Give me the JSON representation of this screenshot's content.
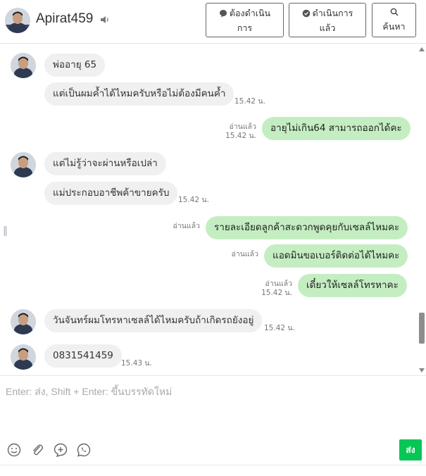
{
  "header": {
    "username": "Apirat459",
    "btn_todo_line1": "ต้องดำเนิน",
    "btn_todo_line2": "การ",
    "btn_done_line1": "ดำเนินการ",
    "btn_done_line2": "แล้ว",
    "btn_search": "ค้นหา"
  },
  "messages": [
    {
      "text": "พ่ออายุ 65"
    },
    {
      "text": "แต่เป็นผมค้ำได้ไหมครับหรือไม่ต้องมีคนค้ำ",
      "time": "15.42 น."
    },
    {
      "text": "อายุไม่เกิน64 สามารถออกได้คะ",
      "read": "อ่านแล้ว",
      "time": "15.42 น."
    },
    {
      "text": "แต่ไม่รู้ว่าจะผ่านหรือเปล่า"
    },
    {
      "text": "แม่ประกอบอาชีพค้าขายครับ",
      "time": "15.42 น."
    },
    {
      "text": "รายละเอียดลูกค้าสะดวกพูดคุยกับเซลล์ไหมคะ",
      "read": "อ่านแล้ว"
    },
    {
      "text": "แอดมินขอเบอร์ติดต่อได้ไหมคะ",
      "read": "อ่านแล้ว"
    },
    {
      "text": "เดี๋ยวให้เซลล์โทรหาคะ",
      "read": "อ่านแล้ว",
      "time": "15.42 น."
    },
    {
      "text": "วันจันทร์ผมโทรหาเซลล์ได้ไหมครับถ้าเกิดรถยังอยู่",
      "time": "15.42 น."
    },
    {
      "text": "0831541459",
      "time": "15.43 น."
    }
  ],
  "composer": {
    "placeholder": "Enter: ส่ง, Shift + Enter: ขึ้นบรรทัดใหม่"
  },
  "send_label": "ส่ง",
  "colors": {
    "outgoing_bubble": "#c4eec2",
    "incoming_bubble": "#f0f0f0",
    "send_button": "#06c755"
  },
  "icons": [
    "speaker-icon",
    "chat-bubble-icon",
    "chat-check-icon",
    "search-icon",
    "emoji-icon",
    "attachment-icon",
    "add-circle-icon",
    "whatsapp-call-icon"
  ]
}
